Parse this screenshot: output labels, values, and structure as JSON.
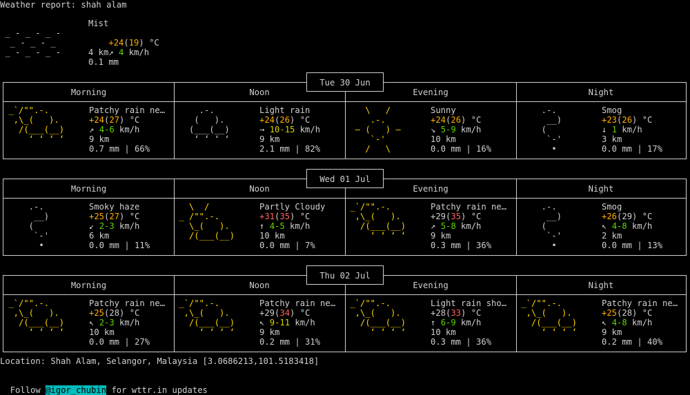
{
  "title": "Weather report: shah alam",
  "current": {
    "icon": [
      " _ - _ - _ -",
      "  _ - _ - _",
      " _ - _ - _ -"
    ],
    "condition": "Mist",
    "temp_main": "+24",
    "temp_feel": "19",
    "temp_unit": "°C",
    "wind_dir": "↗",
    "wind_speed": "4",
    "wind_unit": "km/h",
    "visibility": "4 km",
    "precip": "0.1 mm"
  },
  "colors": {
    "temp_yellow": "#ffaf00",
    "temp_amber": "#ffd700",
    "temp_red": "#ff5f5f",
    "wind_green": "#5fd700",
    "wind_yellow": "#d7d700",
    "icon_yellow": "#ffd700",
    "text": "#d0d0d0",
    "handle_bg": "#00bcbc"
  },
  "period_headers": [
    "Morning",
    "Noon",
    "Evening",
    "Night"
  ],
  "days": [
    {
      "date": "Tue 30 Jun",
      "periods": [
        {
          "icon_type": "patchy",
          "desc": "Patchy rain ne…",
          "temp": "+24",
          "feel": "27",
          "temp_color": "#ffaf00",
          "feel_color": "#ffaf00",
          "wind_dir": "↗",
          "wind": "4-6",
          "wind_color": "#5fd700",
          "vis": "9 km",
          "rain": "0.7 mm | 66%"
        },
        {
          "icon_type": "light-rain",
          "desc": "Light rain",
          "temp": "+24",
          "feel": "26",
          "temp_color": "#ffaf00",
          "feel_color": "#ffaf00",
          "wind_dir": "→",
          "wind": "10-15",
          "wind_color": "#d7d700",
          "vis": "9 km",
          "rain": "2.1 mm | 82%"
        },
        {
          "icon_type": "sunny",
          "desc": "Sunny",
          "temp": "+24",
          "feel": "26",
          "temp_color": "#ffaf00",
          "feel_color": "#ffaf00",
          "wind_dir": "↘",
          "wind": "5-9",
          "wind_color": "#5fd700",
          "vis": "10 km",
          "rain": "0.0 mm | 16%"
        },
        {
          "icon_type": "smog",
          "desc": "Smog",
          "temp": "+23",
          "feel": "26",
          "temp_color": "#ffaf00",
          "feel_color": "#ffaf00",
          "wind_dir": "↓",
          "wind": "1",
          "wind_color": "#5fd700",
          "vis": "3 km",
          "rain": "0.0 mm | 17%"
        }
      ]
    },
    {
      "date": "Wed 01 Jul",
      "periods": [
        {
          "icon_type": "smog",
          "desc": "Smoky haze",
          "temp": "+25",
          "feel": "27",
          "temp_color": "#ffaf00",
          "feel_color": "#ffaf00",
          "wind_dir": "↙",
          "wind": "2-3",
          "wind_color": "#5fd700",
          "vis": "6 km",
          "rain": "0.0 mm | 11%"
        },
        {
          "icon_type": "partly-cloudy",
          "desc": "Partly Cloudy",
          "temp": "+31",
          "feel": "35",
          "temp_color": "#ff5f5f",
          "feel_color": "#ff5f5f",
          "wind_dir": "↑",
          "wind": "4-5",
          "wind_color": "#5fd700",
          "vis": "10 km",
          "rain": "0.0 mm | 7%"
        },
        {
          "icon_type": "patchy",
          "desc": "Patchy rain ne…",
          "temp": "+29",
          "feel": "35",
          "temp_color": "#d0d0d0",
          "feel_color": "#ff5f5f",
          "wind_dir": "↗",
          "wind": "5-8",
          "wind_color": "#5fd700",
          "vis": "9 km",
          "rain": "0.3 mm | 36%"
        },
        {
          "icon_type": "smog",
          "desc": "Smog",
          "temp": "+26",
          "feel": "29",
          "temp_color": "#ffaf00",
          "feel_color": "#d0d0d0",
          "wind_dir": "↖",
          "wind": "4-8",
          "wind_color": "#5fd700",
          "vis": "2 km",
          "rain": "0.0 mm | 13%"
        }
      ]
    },
    {
      "date": "Thu 02 Jul",
      "periods": [
        {
          "icon_type": "patchy",
          "desc": "Patchy rain ne…",
          "temp": "+25",
          "feel": "28",
          "temp_color": "#ffaf00",
          "feel_color": "#d0d0d0",
          "wind_dir": "↖",
          "wind": "2-3",
          "wind_color": "#5fd700",
          "vis": "10 km",
          "rain": "0.0 mm | 27%"
        },
        {
          "icon_type": "patchy",
          "desc": "Patchy rain ne…",
          "temp": "+29",
          "feel": "34",
          "temp_color": "#d0d0d0",
          "feel_color": "#ff5f5f",
          "wind_dir": "↖",
          "wind": "9-11",
          "wind_color": "#d7d700",
          "vis": "9 km",
          "rain": "0.2 mm | 31%"
        },
        {
          "icon_type": "patchy",
          "desc": "Light rain sho…",
          "temp": "+28",
          "feel": "33",
          "temp_color": "#d0d0d0",
          "feel_color": "#ff5f5f",
          "wind_dir": "↑",
          "wind": "6-9",
          "wind_color": "#5fd700",
          "vis": "10 km",
          "rain": "0.3 mm | 36%"
        },
        {
          "icon_type": "patchy",
          "desc": "Patchy rain ne…",
          "temp": "+25",
          "feel": "28",
          "temp_color": "#ffaf00",
          "feel_color": "#d0d0d0",
          "wind_dir": "↖",
          "wind": "4-8",
          "wind_color": "#5fd700",
          "vis": "9 km",
          "rain": "0.2 mm | 40%"
        }
      ]
    }
  ],
  "icons": {
    "patchy": [
      " _`/\"\".-.",
      "  ,\\_(   ).",
      "   /(___(__)",
      "     ʻ ʻ ʻ ʻ"
    ],
    "light-rain": [
      "     .-.",
      "    (   ).",
      "   (___(__)",
      "    ʻ ʻ ʻ ʻ"
    ],
    "sunny": [
      "    \\   /",
      "     .-.",
      "  ― (   ) ―",
      "     `-'",
      "    /   \\"
    ],
    "smog": [
      "     .-.",
      "      __)",
      "     (",
      "      `-'",
      "       •"
    ],
    "partly-cloudy": [
      "   \\  /",
      " _ /\"\".-.",
      "   \\_(   ).",
      "   /(___(__)"
    ]
  },
  "location": "Location: Shah Alam, Selangor, Malaysia [3.0686213,101.5183418]",
  "follow": {
    "prefix": "Follow ",
    "handle": "@igor_chubin",
    "suffix": " for wttr.in updates"
  }
}
